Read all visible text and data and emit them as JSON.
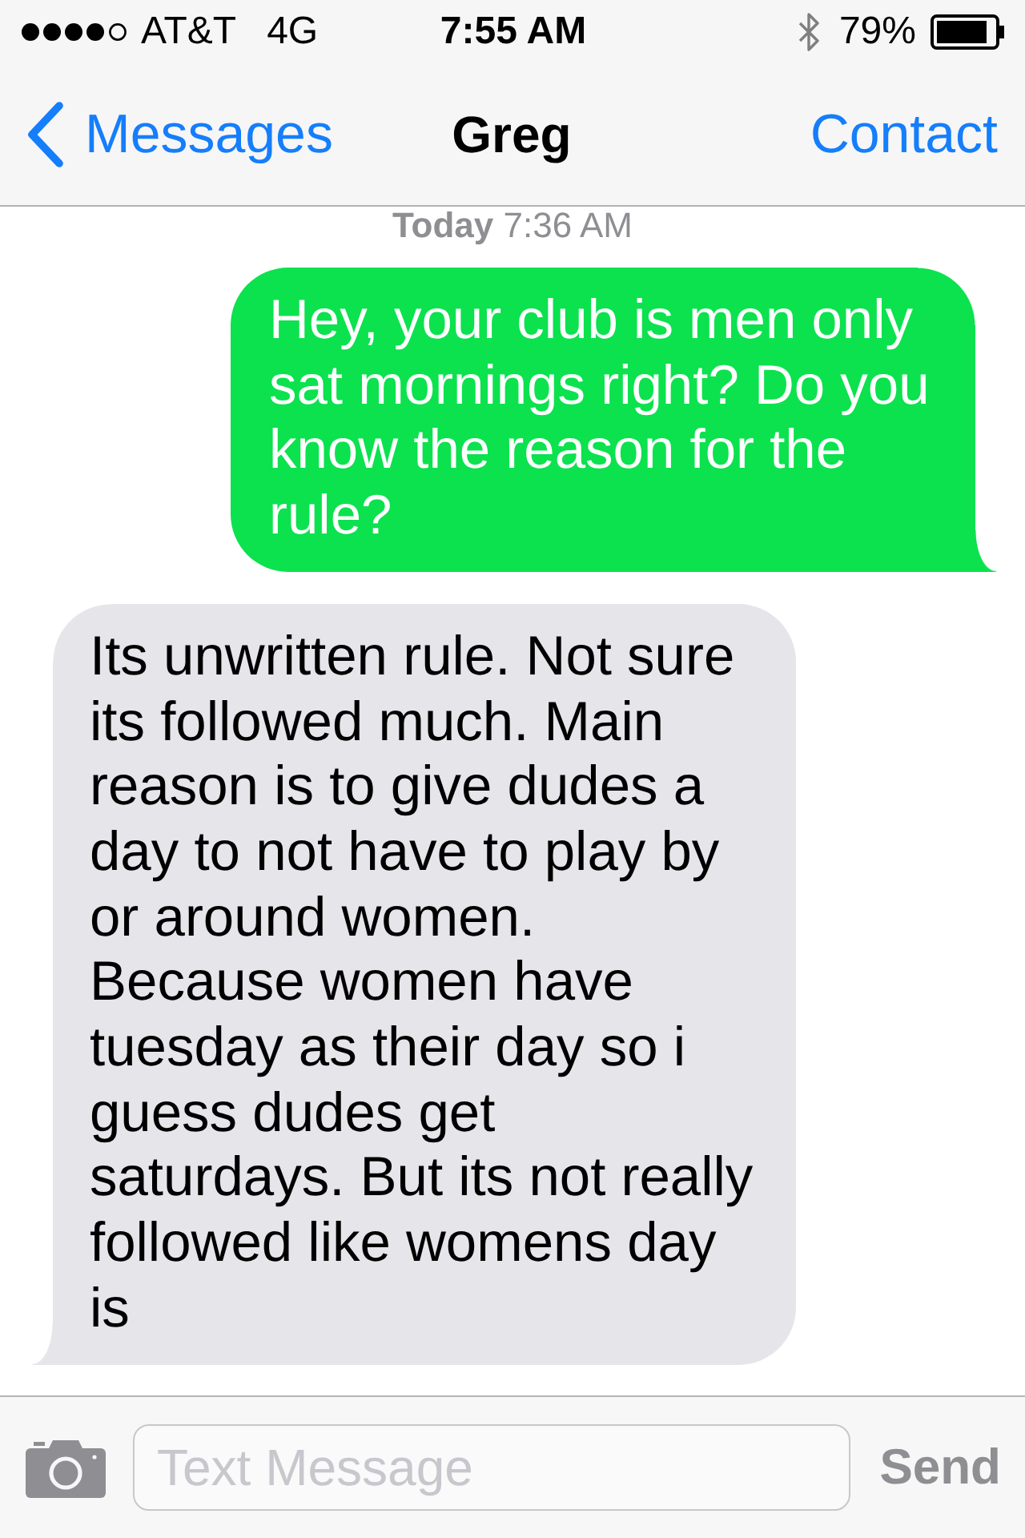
{
  "status_bar": {
    "carrier": "AT&T",
    "network": "4G",
    "time": "7:55 AM",
    "battery": "79%"
  },
  "nav_bar": {
    "back_label": "Messages",
    "title": "Greg",
    "action": "Contact"
  },
  "conversation": {
    "timestamp": "**Today** 7:36 AM",
    "messages": [
      {
        "kind": "sent",
        "text": "Hey, your club is men only sat mornings right? Do you know the reason for the rule?"
      },
      {
        "kind": "received",
        "text": "Its unwritten rule. Not sure its followed much. Main reason is to give dudes a day to not have to play by or around women. Because women have tuesday as their day so i guess dudes get saturdays. But its not really followed like womens day is"
      }
    ]
  },
  "composer": {
    "placeholder": "Text Message",
    "send": {
      "label": "Send",
      "disabled": true
    }
  }
}
